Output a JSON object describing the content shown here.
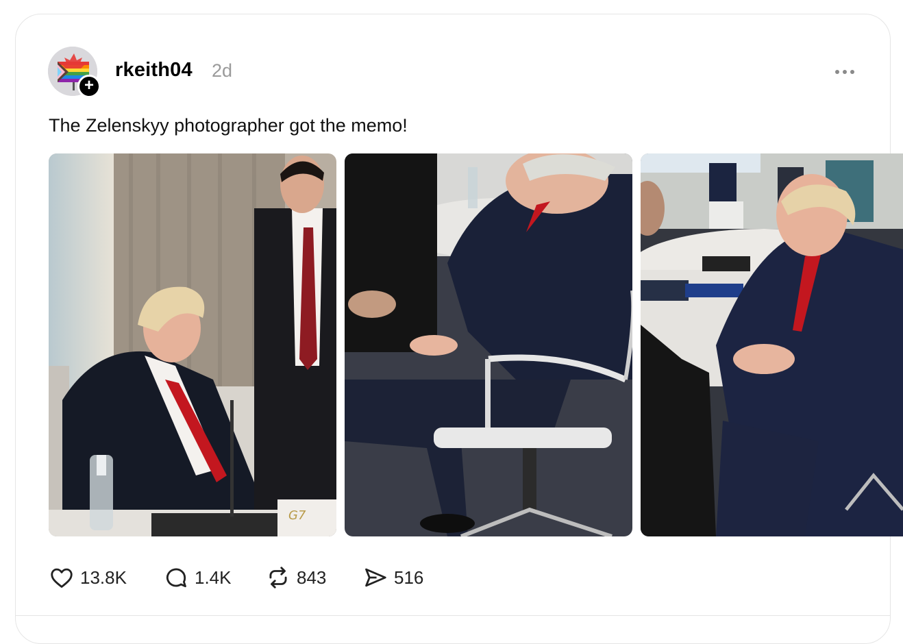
{
  "post": {
    "username": "rkeith04",
    "timestamp": "2d",
    "text": "The Zelenskyy photographer got the memo!",
    "follow_symbol": "+",
    "more_icon": "more-horizontal-icon",
    "photos": [
      {
        "label": "photo-1",
        "caption": "Seated man in suit at meeting table, another man standing"
      },
      {
        "label": "photo-2",
        "caption": "Man in navy suit sitting in office chair"
      },
      {
        "label": "photo-3",
        "caption": "Two men seated in conversation near round table"
      }
    ],
    "g7_label": "G7"
  },
  "actions": {
    "likes": "13.8K",
    "replies": "1.4K",
    "reposts": "843",
    "shares": "516"
  },
  "colors": {
    "username": "#000000",
    "timestamp": "#9a9a9a",
    "suit_navy": "#1c2233",
    "tie_red": "#b21a22",
    "border": "#e5e5e5"
  }
}
